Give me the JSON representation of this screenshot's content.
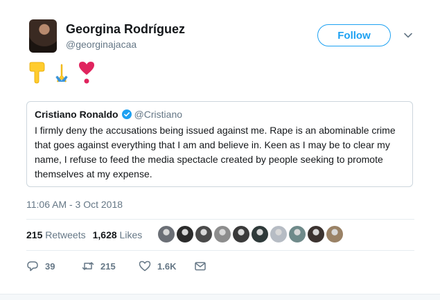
{
  "author": {
    "name": "Georgina Rodríguez",
    "handle": "@georginajacaa"
  },
  "follow_label": "Follow",
  "emojis": [
    "backhand-index-pointing-down",
    "folded-hands",
    "heavy-heart-exclamation"
  ],
  "quoted_tweet": {
    "name": "Cristiano Ronaldo",
    "handle": "@Cristiano",
    "text": "I firmly deny the accusations being issued against me. Rape is an abominable crime that goes against everything that I am and believe in. Keen as I may be to clear my name, I refuse to feed the media spectacle created by people seeking to promote themselves at my expense."
  },
  "timestamp": "11:06 AM - 3 Oct 2018",
  "stats": {
    "retweets_count": "215",
    "retweets_label": "Retweets",
    "likes_count": "1,628",
    "likes_label": "Likes"
  },
  "likers_count": 10,
  "actions": {
    "replies": "39",
    "retweets": "215",
    "likes": "1.6K"
  },
  "colors": {
    "accent": "#1da1f2",
    "muted": "#657786",
    "border": "#ccd6dd"
  }
}
